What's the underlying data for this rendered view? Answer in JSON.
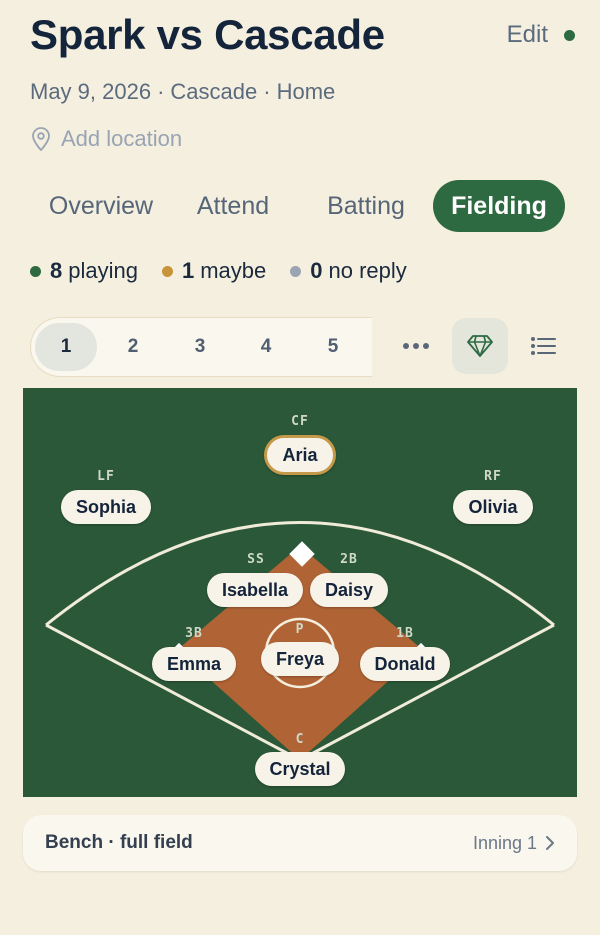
{
  "header": {
    "title": "Spark vs Cascade",
    "edit_label": "Edit",
    "status_color": "#2d6a42"
  },
  "meta": {
    "date": "May 9, 2026",
    "opponent": "Cascade",
    "venue": "Home",
    "separator": "·"
  },
  "location": {
    "placeholder": "Add location",
    "icon": "map-pin-icon"
  },
  "tabs": [
    {
      "label": "Overview",
      "active": false
    },
    {
      "label": "Attend",
      "active": false
    },
    {
      "label": "Batting",
      "active": false
    },
    {
      "label": "Fielding",
      "active": true
    }
  ],
  "summary": {
    "playing": {
      "count": "8",
      "label": "playing",
      "color": "#2d6a42"
    },
    "maybe": {
      "count": "1",
      "label": "maybe",
      "color": "#c8943a"
    },
    "no_reply": {
      "count": "0",
      "label": "no reply",
      "color": "#9aa4b2"
    }
  },
  "innings": {
    "items": [
      "1",
      "2",
      "3",
      "4",
      "5"
    ],
    "selected": "1"
  },
  "controls": {
    "more": "more-dots-icon",
    "view_field": "gem-icon",
    "view_list": "list-icon"
  },
  "colors": {
    "grass": "#2b5838",
    "infield": "#b06435",
    "accent": "#2d6a42",
    "highlight": "#c49a4a"
  },
  "field": {
    "positions": [
      {
        "code": "CF",
        "player": "Aria",
        "highlight": true
      },
      {
        "code": "LF",
        "player": "Sophia"
      },
      {
        "code": "RF",
        "player": "Olivia"
      },
      {
        "code": "SS",
        "player": "Isabella"
      },
      {
        "code": "2B",
        "player": "Daisy"
      },
      {
        "code": "3B",
        "player": "Emma"
      },
      {
        "code": "P",
        "player": "Freya"
      },
      {
        "code": "1B",
        "player": "Donald"
      },
      {
        "code": "C",
        "player": "Crystal"
      }
    ]
  },
  "bench": {
    "title": "Bench · full field",
    "inning_label": "Inning 1"
  }
}
